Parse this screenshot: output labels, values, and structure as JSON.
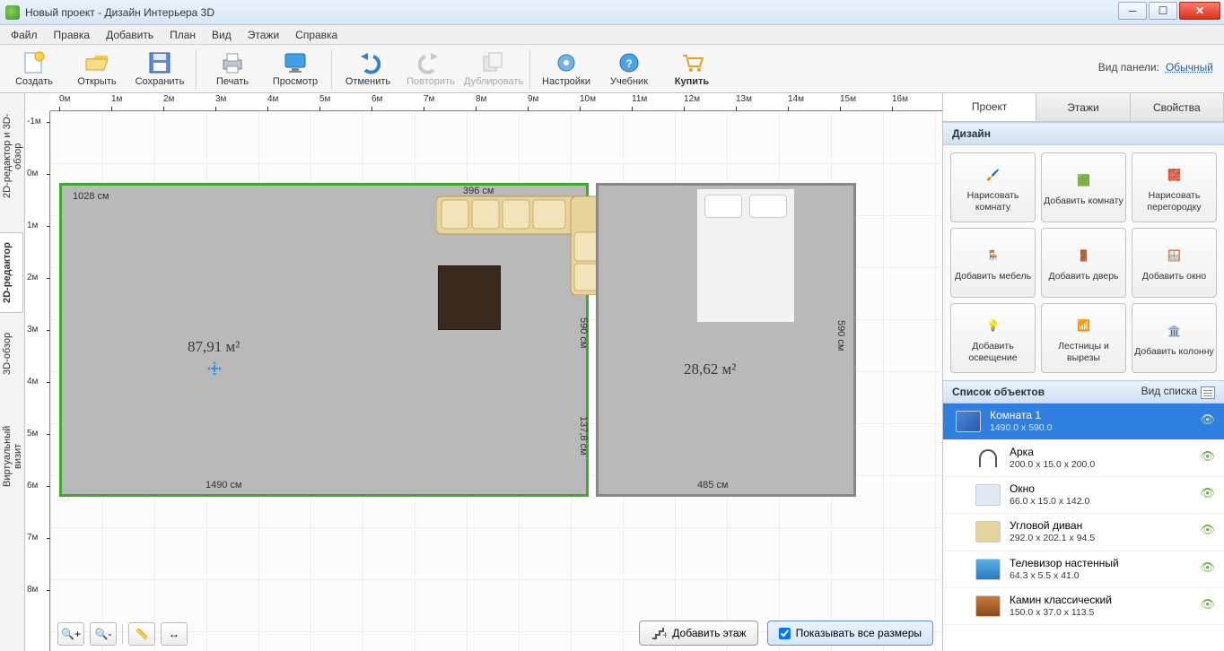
{
  "window": {
    "title": "Новый проект - Дизайн Интерьера 3D"
  },
  "menus": [
    "Файл",
    "Правка",
    "Добавить",
    "План",
    "Вид",
    "Этажи",
    "Справка"
  ],
  "toolbar": {
    "create": "Создать",
    "open": "Открыть",
    "save": "Сохранить",
    "print": "Печать",
    "preview": "Просмотр",
    "undo": "Отменить",
    "redo": "Повторить",
    "duplicate": "Дублировать",
    "settings": "Настройки",
    "tutorial": "Учебник",
    "buy": "Купить",
    "panel_mode_label": "Вид панели:",
    "panel_mode_value": "Обычный"
  },
  "left_tabs": {
    "t1": "2D-редактор и 3D-обзор",
    "t2": "2D-редактор",
    "t3": "3D-обзор",
    "t4": "Виртуальный визит"
  },
  "ruler": {
    "h": [
      "0м",
      "1м",
      "2м",
      "3м",
      "4м",
      "5м",
      "6м",
      "7м",
      "8м",
      "9м",
      "10м",
      "11м",
      "12м",
      "13м",
      "14м",
      "15м",
      "16м"
    ],
    "v": [
      "-1м",
      "0м",
      "1м",
      "2м",
      "3м",
      "4м",
      "5м",
      "6м",
      "7м",
      "8м"
    ]
  },
  "plan": {
    "room1": {
      "area": "87,91 м²",
      "top": "1028 см",
      "bottom": "1490 см"
    },
    "room2": {
      "area": "28,62 м²",
      "top": "485 см",
      "bottom": "485 см",
      "right": "590 см"
    },
    "sofa_dim": "396 см",
    "door_h": "137,8 см",
    "mid_right": "590 см"
  },
  "canvas_buttons": {
    "add_floor": "Добавить этаж",
    "show_all": "Показывать все размеры"
  },
  "right": {
    "tabs": [
      "Проект",
      "Этажи",
      "Свойства"
    ],
    "design_header": "Дизайн",
    "cards": [
      "Нарисовать комнату",
      "Добавить комнату",
      "Нарисовать перегородку",
      "Добавить мебель",
      "Добавить дверь",
      "Добавить окно",
      "Добавить освещение",
      "Лестницы и вырезы",
      "Добавить колонну"
    ],
    "objects_header": "Список объектов",
    "list_mode": "Вид списка",
    "items": [
      {
        "name": "Комната 1",
        "dims": "1490.0 x 590.0",
        "sel": true
      },
      {
        "name": "Арка",
        "dims": "200.0 x 15.0 x 200.0"
      },
      {
        "name": "Окно",
        "dims": "66.0 x 15.0 x 142.0"
      },
      {
        "name": "Угловой диван",
        "dims": "292.0 x 202.1 x 94.5"
      },
      {
        "name": "Телевизор настенный",
        "dims": "64.3 x 5.5 x 41.0"
      },
      {
        "name": "Камин классический",
        "dims": "150.0 x 37.0 x 113.5"
      }
    ]
  }
}
